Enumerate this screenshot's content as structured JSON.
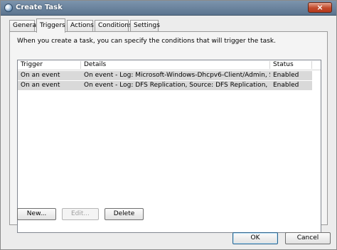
{
  "window": {
    "title": "Create Task",
    "close_glyph": "×",
    "title_icon": "task-scheduler-icon"
  },
  "tabs": [
    {
      "label": "General"
    },
    {
      "label": "Triggers"
    },
    {
      "label": "Actions"
    },
    {
      "label": "Conditions"
    },
    {
      "label": "Settings"
    }
  ],
  "active_tab": "Triggers",
  "instruction": "When you create a task, you can specify the conditions that will trigger the task.",
  "table": {
    "headers": [
      "Trigger",
      "Details",
      "Status"
    ],
    "rows": [
      {
        "trigger": "On an event",
        "details": "On event - Log: Microsoft-Windows-Dhcpv6-Client/Admin, Sou...",
        "status": "Enabled"
      },
      {
        "trigger": "On an event",
        "details": "On event - Log: DFS Replication, Source: DFS Replication, Event I...",
        "status": "Enabled"
      }
    ]
  },
  "buttons": {
    "new": "New...",
    "edit": "Edit...",
    "delete": "Delete",
    "ok": "OK",
    "cancel": "Cancel"
  }
}
